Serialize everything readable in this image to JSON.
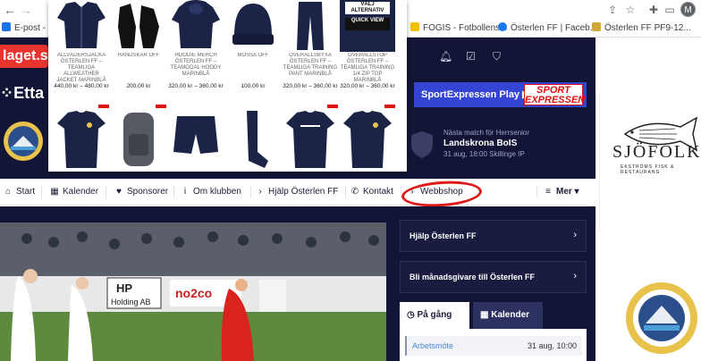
{
  "browser": {
    "back": "←",
    "forward": "→",
    "profile_initial": "M",
    "bookmarks": [
      {
        "label": "E-post - M",
        "color": "#1a73e8"
      },
      {
        "label": "FOGIS - Fotbollens...",
        "color": "#f2c200"
      },
      {
        "label": "Österlen FF | Faceb...",
        "color": "#1877f2"
      },
      {
        "label": "Österlen FF PF9-12...",
        "color": "#cfa838"
      }
    ]
  },
  "site": {
    "logo_laget": "laget.s",
    "logo_etta": "Etta",
    "sx_banner": "SportExpressen Play ▶",
    "sx_logo": "SPORT EXPRESSEN",
    "next_match": {
      "label": "Nästa match för Herrsenior",
      "team": "Landskrona BoIS",
      "date": "31 aug, 18:00 Skillinge IP"
    },
    "sponsor": {
      "name": "SJÖFOLK",
      "tagline": "EKSTRÖMS FISK & RESTAURANG"
    },
    "nav": [
      {
        "label": "Start",
        "icon": "home-icon",
        "glyph": "⌂"
      },
      {
        "label": "Kalender",
        "icon": "calendar-icon",
        "glyph": "▦"
      },
      {
        "label": "Sponsorer",
        "icon": "heart-icon",
        "glyph": "♥"
      },
      {
        "label": "Om klubben",
        "icon": "info-icon",
        "glyph": "i"
      },
      {
        "label": "Hjälp Österlen FF",
        "icon": "chevron-right-icon",
        "glyph": "›"
      },
      {
        "label": "Kontakt",
        "icon": "phone-icon",
        "glyph": "✆"
      },
      {
        "label": "Webbshop",
        "icon": "chevron-right-icon",
        "glyph": "›"
      }
    ],
    "nav_more": "Mer ▾",
    "links": [
      {
        "label": "Hjälp Österlen FF"
      },
      {
        "label": "Bli månadsgivare till Österlen FF"
      }
    ],
    "tabs": [
      {
        "label": "På gång",
        "icon": "clock-icon",
        "glyph": "◷"
      },
      {
        "label": "Kalender",
        "icon": "calendar-icon",
        "glyph": "▦"
      }
    ],
    "event": {
      "name": "Arbetsmöte",
      "date": "31 aug, 10:00"
    }
  },
  "shop": {
    "products": [
      {
        "name": "ALLVÄDERSJACKA ÖSTERLEN FF – TEAMLIGA ALLWEATHER JACKET MARINBLÅ",
        "price": "440,00 kr – 480,00 kr",
        "kind": "jacket",
        "color": "#1b2347"
      },
      {
        "name": "HANDSKAR ÖFF",
        "price": "200,00 kr",
        "kind": "gloves",
        "color": "#111111"
      },
      {
        "name": "HOODIE MERCH ÖSTERLEN FF – TEAMGOAL HOODY MARINBLÅ",
        "price": "320,00 kr – 360,00 kr",
        "kind": "hoodie",
        "color": "#1b2347"
      },
      {
        "name": "MÖSSA ÖFF",
        "price": "100,00 kr",
        "kind": "beanie",
        "color": "#1b2347"
      },
      {
        "name": "OVERALLSBYXA ÖSTERLEN FF – TEAMLIGA TRAINING PANT MARINBLÅ",
        "price": "320,00 kr – 360,00 kr",
        "kind": "pants",
        "color": "#1b2347"
      },
      {
        "name": "OVERALLSTOP ÖSTERLEN FF – TEAMLIGA TRAINING 1/4 ZIP TOP MARINBLÅ",
        "price": "320,00 kr – 360,00 kr",
        "kind": "zip",
        "color": "#1b2347",
        "badges": [
          "VÄLJ ALTERNATIV",
          "QUICK VIEW"
        ]
      }
    ],
    "row2": [
      {
        "kind": "tshirt",
        "color": "#1b2347"
      },
      {
        "kind": "backpack",
        "color": "#555a62"
      },
      {
        "kind": "shorts",
        "color": "#1b2347"
      },
      {
        "kind": "socks",
        "color": "#1b2347"
      },
      {
        "kind": "tshirt",
        "color": "#1b2347"
      },
      {
        "kind": "tshirt",
        "color": "#1b2347"
      }
    ]
  },
  "colors": {
    "site_dark": "#131536",
    "sx_blue": "#3445d6",
    "highlight_circle": "#e01818",
    "event_link": "#4a87d6"
  }
}
